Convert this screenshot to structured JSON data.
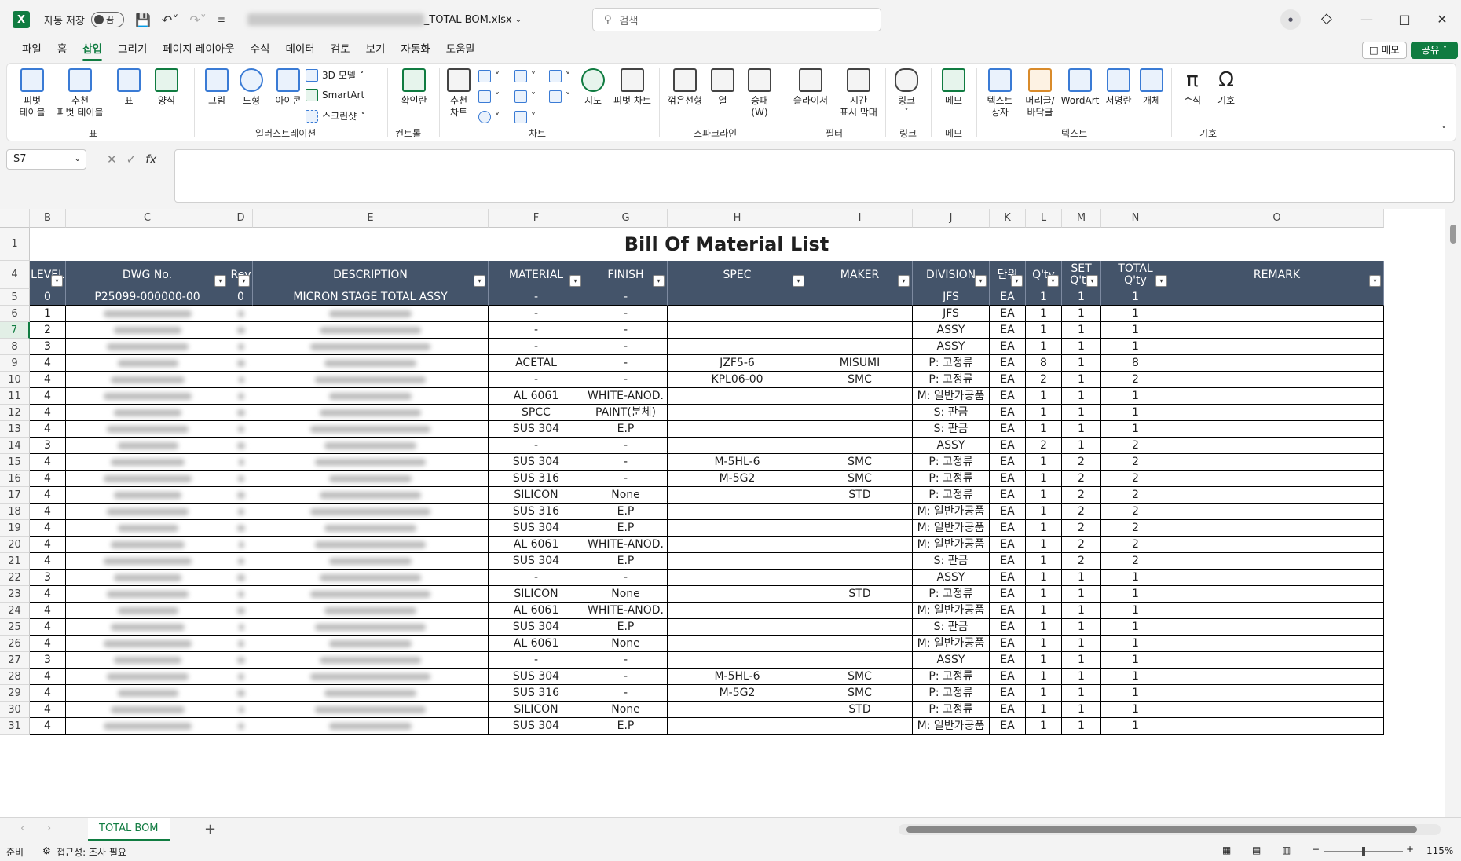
{
  "titlebar": {
    "autosave_label": "자동 저장",
    "toggle_state": "끔",
    "filename": "_TOTAL BOM.xlsx",
    "search_placeholder": "검색"
  },
  "menu": {
    "tabs": [
      "파일",
      "홈",
      "삽입",
      "그리기",
      "페이지 레이아웃",
      "수식",
      "데이터",
      "검토",
      "보기",
      "자동화",
      "도움말"
    ],
    "active_tab": "삽입",
    "memo_button": "메모",
    "share_button": "공유"
  },
  "ribbon": {
    "pivot_table": "피벗\n테이블",
    "recommended_pivot": "추천\n피벗 테이블",
    "table": "표",
    "forms": "양식",
    "pictures": "그림",
    "shapes": "도형",
    "icons": "아이콘",
    "models_3d": "3D 모델",
    "smartart": "SmartArt",
    "screenshot": "스크린샷",
    "checkbox": "확인란",
    "recommended_charts": "추천\n차트",
    "maps": "지도",
    "pivot_chart": "피벗 차트",
    "spark_line": "꺾은선형",
    "spark_column": "열",
    "spark_winloss": "승패\n(W)",
    "slicer": "슬라이서",
    "timeline": "시간\n표시 막대",
    "link": "링크",
    "comment": "메모",
    "textbox": "텍스트\n상자",
    "header_footer": "머리글/\n바닥글",
    "wordart": "WordArt",
    "signature": "서명란",
    "object": "개체",
    "equation": "수식",
    "symbol": "기호",
    "groups": [
      "표",
      "일러스트레이션",
      "컨트롤",
      "차트",
      "스파크라인",
      "필터",
      "링크",
      "메모",
      "텍스트",
      "기호"
    ]
  },
  "formula_bar": {
    "name_box": "S7",
    "fx": "fx",
    "formula": ""
  },
  "columns": [
    "B",
    "C",
    "D",
    "E",
    "F",
    "G",
    "H",
    "I",
    "J",
    "K",
    "L",
    "M",
    "N",
    "O"
  ],
  "sheet_title": "Bill Of Material List",
  "table_headers": [
    "LEVEL",
    "DWG No.",
    "Rev",
    "DESCRIPTION",
    "MATERIAL",
    "FINISH",
    "SPEC",
    "MAKER",
    "DIVISION",
    "단위",
    "Q'ty",
    "SET\nQ'ty",
    "TOTAL\nQ'ty",
    "REMARK"
  ],
  "rows": [
    {
      "r": "1"
    },
    {
      "r": "4"
    },
    {
      "r": "5",
      "level": "0",
      "dwg": "P25099-000000-00",
      "rev": "0",
      "desc": "MICRON STAGE TOTAL ASSY",
      "material": "-",
      "finish": "-",
      "spec": "",
      "maker": "",
      "division": "JFS",
      "unit": "EA",
      "qty": "1",
      "set": "1",
      "total": "1"
    },
    {
      "r": "6",
      "level": "1",
      "material": "-",
      "finish": "-",
      "spec": "",
      "maker": "",
      "division": "JFS",
      "unit": "EA",
      "qty": "1",
      "set": "1",
      "total": "1"
    },
    {
      "r": "7",
      "level": "2",
      "material": "-",
      "finish": "-",
      "spec": "",
      "maker": "",
      "division": "ASSY",
      "unit": "EA",
      "qty": "1",
      "set": "1",
      "total": "1"
    },
    {
      "r": "8",
      "level": "3",
      "material": "-",
      "finish": "-",
      "spec": "",
      "maker": "",
      "division": "ASSY",
      "unit": "EA",
      "qty": "1",
      "set": "1",
      "total": "1"
    },
    {
      "r": "9",
      "level": "4",
      "material": "ACETAL",
      "finish": "-",
      "spec": "JZF5-6",
      "maker": "MISUMI",
      "division": "P: 고정류",
      "unit": "EA",
      "qty": "8",
      "set": "1",
      "total": "8"
    },
    {
      "r": "10",
      "level": "4",
      "material": "-",
      "finish": "-",
      "spec": "KPL06-00",
      "maker": "SMC",
      "division": "P: 고정류",
      "unit": "EA",
      "qty": "2",
      "set": "1",
      "total": "2"
    },
    {
      "r": "11",
      "level": "4",
      "material": "AL 6061",
      "finish": "WHITE-ANOD.",
      "spec": "",
      "maker": "",
      "division": "M: 일반가공품",
      "unit": "EA",
      "qty": "1",
      "set": "1",
      "total": "1"
    },
    {
      "r": "12",
      "level": "4",
      "material": "SPCC",
      "finish": "PAINT(분체)",
      "spec": "",
      "maker": "",
      "division": "S: 판금",
      "unit": "EA",
      "qty": "1",
      "set": "1",
      "total": "1"
    },
    {
      "r": "13",
      "level": "4",
      "material": "SUS 304",
      "finish": "E.P",
      "spec": "",
      "maker": "",
      "division": "S: 판금",
      "unit": "EA",
      "qty": "1",
      "set": "1",
      "total": "1"
    },
    {
      "r": "14",
      "level": "3",
      "material": "-",
      "finish": "-",
      "spec": "",
      "maker": "",
      "division": "ASSY",
      "unit": "EA",
      "qty": "2",
      "set": "1",
      "total": "2"
    },
    {
      "r": "15",
      "level": "4",
      "material": "SUS 304",
      "finish": "-",
      "spec": "M-5HL-6",
      "maker": "SMC",
      "division": "P: 고정류",
      "unit": "EA",
      "qty": "1",
      "set": "2",
      "total": "2"
    },
    {
      "r": "16",
      "level": "4",
      "material": "SUS 316",
      "finish": "-",
      "spec": "M-5G2",
      "maker": "SMC",
      "division": "P: 고정류",
      "unit": "EA",
      "qty": "1",
      "set": "2",
      "total": "2"
    },
    {
      "r": "17",
      "level": "4",
      "material": "SILICON",
      "finish": "None",
      "spec": "",
      "maker": "STD",
      "division": "P: 고정류",
      "unit": "EA",
      "qty": "1",
      "set": "2",
      "total": "2"
    },
    {
      "r": "18",
      "level": "4",
      "material": "SUS 316",
      "finish": "E.P",
      "spec": "",
      "maker": "",
      "division": "M: 일반가공품",
      "unit": "EA",
      "qty": "1",
      "set": "2",
      "total": "2"
    },
    {
      "r": "19",
      "level": "4",
      "material": "SUS 304",
      "finish": "E.P",
      "spec": "",
      "maker": "",
      "division": "M: 일반가공품",
      "unit": "EA",
      "qty": "1",
      "set": "2",
      "total": "2"
    },
    {
      "r": "20",
      "level": "4",
      "material": "AL 6061",
      "finish": "WHITE-ANOD.",
      "spec": "",
      "maker": "",
      "division": "M: 일반가공품",
      "unit": "EA",
      "qty": "1",
      "set": "2",
      "total": "2"
    },
    {
      "r": "21",
      "level": "4",
      "material": "SUS 304",
      "finish": "E.P",
      "spec": "",
      "maker": "",
      "division": "S: 판금",
      "unit": "EA",
      "qty": "1",
      "set": "2",
      "total": "2"
    },
    {
      "r": "22",
      "level": "3",
      "material": "-",
      "finish": "-",
      "spec": "",
      "maker": "",
      "division": "ASSY",
      "unit": "EA",
      "qty": "1",
      "set": "1",
      "total": "1"
    },
    {
      "r": "23",
      "level": "4",
      "material": "SILICON",
      "finish": "None",
      "spec": "",
      "maker": "STD",
      "division": "P: 고정류",
      "unit": "EA",
      "qty": "1",
      "set": "1",
      "total": "1"
    },
    {
      "r": "24",
      "level": "4",
      "material": "AL 6061",
      "finish": "WHITE-ANOD.",
      "spec": "",
      "maker": "",
      "division": "M: 일반가공품",
      "unit": "EA",
      "qty": "1",
      "set": "1",
      "total": "1"
    },
    {
      "r": "25",
      "level": "4",
      "material": "SUS 304",
      "finish": "E.P",
      "spec": "",
      "maker": "",
      "division": "S: 판금",
      "unit": "EA",
      "qty": "1",
      "set": "1",
      "total": "1"
    },
    {
      "r": "26",
      "level": "4",
      "material": "AL 6061",
      "finish": "None",
      "spec": "",
      "maker": "",
      "division": "M: 일반가공품",
      "unit": "EA",
      "qty": "1",
      "set": "1",
      "total": "1"
    },
    {
      "r": "27",
      "level": "3",
      "material": "-",
      "finish": "-",
      "spec": "",
      "maker": "",
      "division": "ASSY",
      "unit": "EA",
      "qty": "1",
      "set": "1",
      "total": "1"
    },
    {
      "r": "28",
      "level": "4",
      "material": "SUS 304",
      "finish": "-",
      "spec": "M-5HL-6",
      "maker": "SMC",
      "division": "P: 고정류",
      "unit": "EA",
      "qty": "1",
      "set": "1",
      "total": "1"
    },
    {
      "r": "29",
      "level": "4",
      "material": "SUS 316",
      "finish": "-",
      "spec": "M-5G2",
      "maker": "SMC",
      "division": "P: 고정류",
      "unit": "EA",
      "qty": "1",
      "set": "1",
      "total": "1"
    },
    {
      "r": "30",
      "level": "4",
      "material": "SILICON",
      "finish": "None",
      "spec": "",
      "maker": "STD",
      "division": "P: 고정류",
      "unit": "EA",
      "qty": "1",
      "set": "1",
      "total": "1"
    },
    {
      "r": "31",
      "level": "4",
      "material": "SUS 304",
      "finish": "E.P",
      "spec": "",
      "maker": "",
      "division": "M: 일반가공품",
      "unit": "EA",
      "qty": "1",
      "set": "1",
      "total": "1"
    }
  ],
  "sheet_tabs": [
    "TOTAL BOM"
  ],
  "status": {
    "ready": "준비",
    "accessibility": "접근성: 조사 필요",
    "zoom": "115%"
  },
  "colors": {
    "accent": "#107c41",
    "header_fill": "#44546a"
  }
}
